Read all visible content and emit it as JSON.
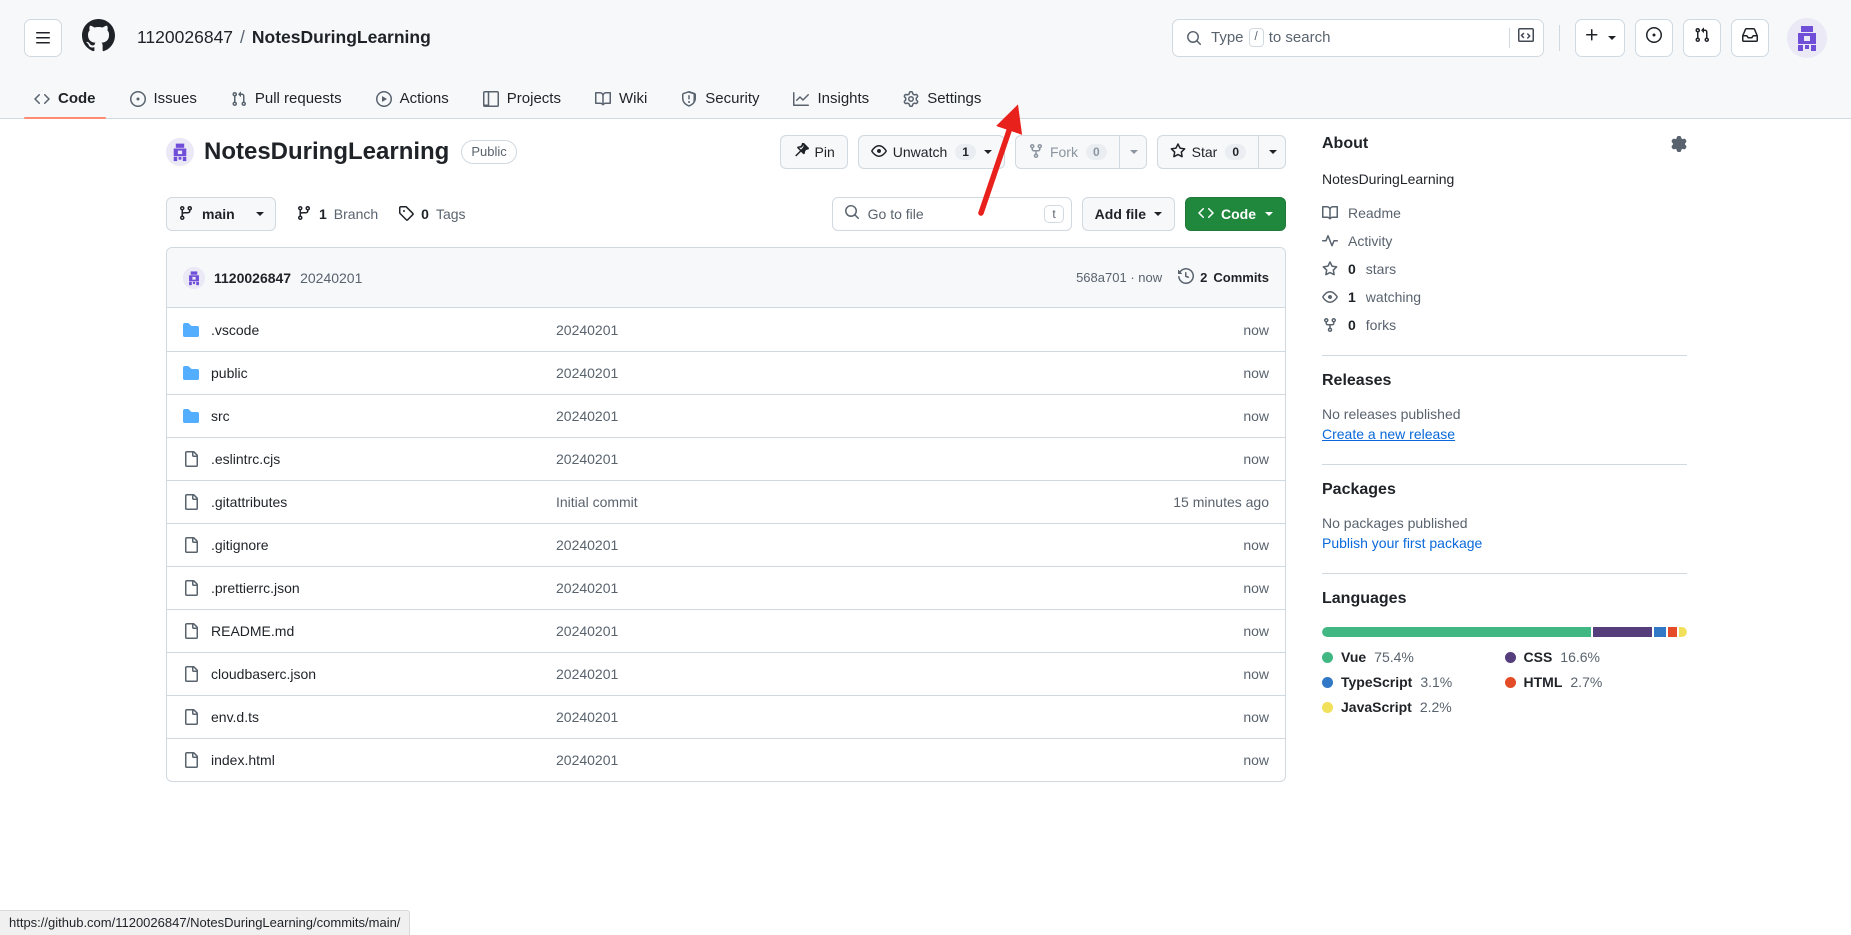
{
  "header": {
    "menu_icon": "hamburger-icon",
    "logo_icon": "github-mark-icon",
    "owner": "1120026847",
    "separator": "/",
    "repo": "NotesDuringLearning",
    "search": {
      "placeholder_pre": "Type",
      "slash_key": "/",
      "placeholder_post": "to search",
      "command_icon": "terminal-icon"
    },
    "actions": {
      "create_new": "plus-icon",
      "create_new_caret": "chevron-down-icon",
      "issues": "issue-opened-icon",
      "pull_requests": "git-pull-request-icon",
      "inbox": "inbox-icon",
      "avatar": "user-avatar"
    }
  },
  "repo_nav": {
    "items": [
      {
        "label": "Code",
        "icon": "code-icon",
        "active": true
      },
      {
        "label": "Issues",
        "icon": "issue-opened-icon",
        "active": false
      },
      {
        "label": "Pull requests",
        "icon": "git-pull-request-icon",
        "active": false
      },
      {
        "label": "Actions",
        "icon": "play-icon",
        "active": false
      },
      {
        "label": "Projects",
        "icon": "table-icon",
        "active": false
      },
      {
        "label": "Wiki",
        "icon": "book-icon",
        "active": false
      },
      {
        "label": "Security",
        "icon": "shield-icon",
        "active": false
      },
      {
        "label": "Insights",
        "icon": "graph-icon",
        "active": false
      },
      {
        "label": "Settings",
        "icon": "gear-icon",
        "active": false
      }
    ]
  },
  "repo_header": {
    "name": "NotesDuringLearning",
    "visibility": "Public",
    "pin_label": "Pin",
    "watch_label": "Unwatch",
    "watch_count": "1",
    "fork_label": "Fork",
    "fork_count": "0",
    "star_label": "Star",
    "star_count": "0"
  },
  "controls": {
    "branch": "main",
    "branch_count": "1",
    "branch_word": "Branch",
    "tag_count": "0",
    "tag_word": "Tags",
    "goto_file_placeholder": "Go to file",
    "goto_file_key": "t",
    "add_file_label": "Add file",
    "code_label": "Code"
  },
  "commit_bar": {
    "author": "1120026847",
    "message": "20240201",
    "hash": "568a701",
    "hash_sep": "·",
    "relative_time": "now",
    "commits_count": "2",
    "commits_word": "Commits"
  },
  "files": {
    "rows": [
      {
        "name": ".vscode",
        "type": "folder",
        "message": "20240201",
        "time": "now"
      },
      {
        "name": "public",
        "type": "folder",
        "message": "20240201",
        "time": "now"
      },
      {
        "name": "src",
        "type": "folder",
        "message": "20240201",
        "time": "now"
      },
      {
        "name": ".eslintrc.cjs",
        "type": "file",
        "message": "20240201",
        "time": "now"
      },
      {
        "name": ".gitattributes",
        "type": "file",
        "message": "Initial commit",
        "time": "15 minutes ago"
      },
      {
        "name": ".gitignore",
        "type": "file",
        "message": "20240201",
        "time": "now"
      },
      {
        "name": ".prettierrc.json",
        "type": "file",
        "message": "20240201",
        "time": "now"
      },
      {
        "name": "README.md",
        "type": "file",
        "message": "20240201",
        "time": "now"
      },
      {
        "name": "cloudbaserc.json",
        "type": "file",
        "message": "20240201",
        "time": "now"
      },
      {
        "name": "env.d.ts",
        "type": "file",
        "message": "20240201",
        "time": "now"
      },
      {
        "name": "index.html",
        "type": "file",
        "message": "20240201",
        "time": "now"
      }
    ]
  },
  "about": {
    "title": "About",
    "gear_icon": "gear-icon",
    "description": "NotesDuringLearning",
    "links": [
      {
        "icon": "book-icon",
        "label": "Readme",
        "value": ""
      },
      {
        "icon": "pulse-icon",
        "label": "Activity",
        "value": ""
      },
      {
        "icon": "star-icon",
        "label": "stars",
        "value": "0"
      },
      {
        "icon": "eye-icon",
        "label": "watching",
        "value": "1"
      },
      {
        "icon": "fork-icon",
        "label": "forks",
        "value": "0"
      }
    ]
  },
  "releases": {
    "title": "Releases",
    "empty_text": "No releases published",
    "action_text": "Create a new release"
  },
  "packages": {
    "title": "Packages",
    "empty_text": "No packages published",
    "action_text": "Publish your first package"
  },
  "languages": {
    "title": "Languages",
    "items": [
      {
        "name": "Vue",
        "percent": "75.4%",
        "value": 75.4,
        "color": "#41b883"
      },
      {
        "name": "CSS",
        "percent": "16.6%",
        "value": 16.6,
        "color": "#563d7c"
      },
      {
        "name": "TypeScript",
        "percent": "3.1%",
        "value": 3.1,
        "color": "#3178c6"
      },
      {
        "name": "HTML",
        "percent": "2.7%",
        "value": 2.7,
        "color": "#e34c26"
      },
      {
        "name": "JavaScript",
        "percent": "2.2%",
        "value": 2.2,
        "color": "#f1e05a"
      }
    ]
  },
  "status_bar": {
    "url": "https://github.com/1120026847/NotesDuringLearning/commits/main/"
  },
  "annotation": {
    "arrow_color": "#e8211c",
    "points_at": "Settings"
  },
  "colors": {
    "accent": "#0969da",
    "green_button": "#1f883d",
    "active_tab_underline": "#fd8c73",
    "border": "#d1d9e0",
    "muted_text": "#59636e",
    "header_bg": "#f6f8fa"
  }
}
